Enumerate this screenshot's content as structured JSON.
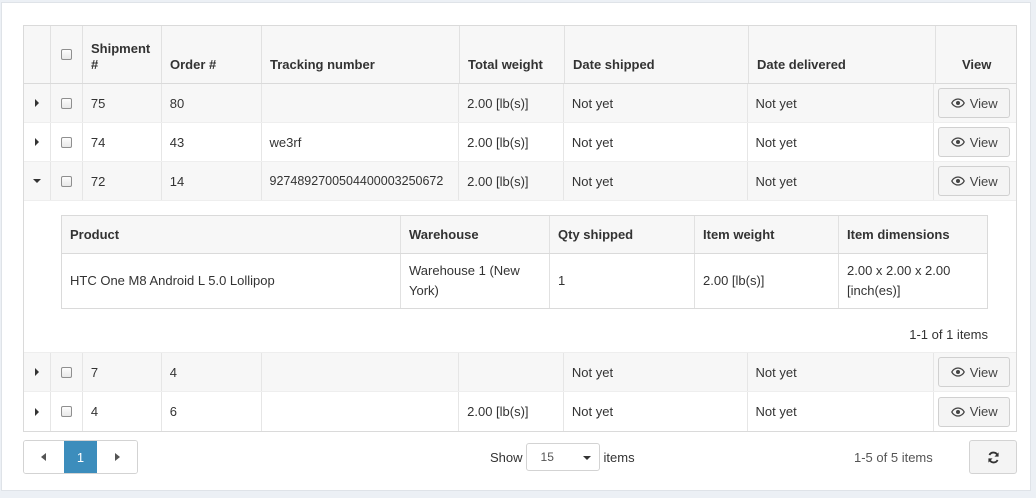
{
  "columns": {
    "shipment": "Shipment #",
    "order": "Order #",
    "tracking": "Tracking number",
    "weight": "Total weight",
    "shipped": "Date shipped",
    "delivered": "Date delivered",
    "view": "View"
  },
  "rows": [
    {
      "shipment": "75",
      "order": "80",
      "tracking": "",
      "weight": "2.00 [lb(s)]",
      "shipped": "Not yet",
      "delivered": "Not yet",
      "view": "View"
    },
    {
      "shipment": "74",
      "order": "43",
      "tracking": "we3rf",
      "weight": "2.00 [lb(s)]",
      "shipped": "Not yet",
      "delivered": "Not yet",
      "view": "View"
    },
    {
      "shipment": "72",
      "order": "14",
      "tracking": "9274892700504400003250672",
      "weight": "2.00 [lb(s)]",
      "shipped": "Not yet",
      "delivered": "Not yet",
      "view": "View"
    },
    {
      "shipment": "7",
      "order": "4",
      "tracking": "",
      "weight": "",
      "shipped": "Not yet",
      "delivered": "Not yet",
      "view": "View"
    },
    {
      "shipment": "4",
      "order": "6",
      "tracking": "",
      "weight": "2.00 [lb(s)]",
      "shipped": "Not yet",
      "delivered": "Not yet",
      "view": "View"
    }
  ],
  "detail": {
    "columns": {
      "product": "Product",
      "warehouse": "Warehouse",
      "qty": "Qty shipped",
      "item_weight": "Item weight",
      "dimensions": "Item dimensions"
    },
    "row": {
      "product": "HTC One M8 Android L 5.0 Lollipop",
      "warehouse": "Warehouse 1 (New York)",
      "qty": "1",
      "item_weight": "2.00 [lb(s)]",
      "dimensions": "2.00 x 2.00 x 2.00 [inch(es)]"
    },
    "pager_info": "1-1 of 1 items"
  },
  "pager": {
    "current_page": "1",
    "show_label": "Show",
    "page_size": "15",
    "items_label": "items",
    "info": "1-5 of 5 items"
  },
  "icons": {
    "expand": "caret-right-icon",
    "collapse": "caret-down-icon",
    "view": "eye-icon",
    "refresh": "refresh-icon"
  },
  "colors": {
    "accent": "#3c8dbc",
    "header_bg": "#f7f7f7",
    "alt_row_bg": "#f7f7f7"
  }
}
